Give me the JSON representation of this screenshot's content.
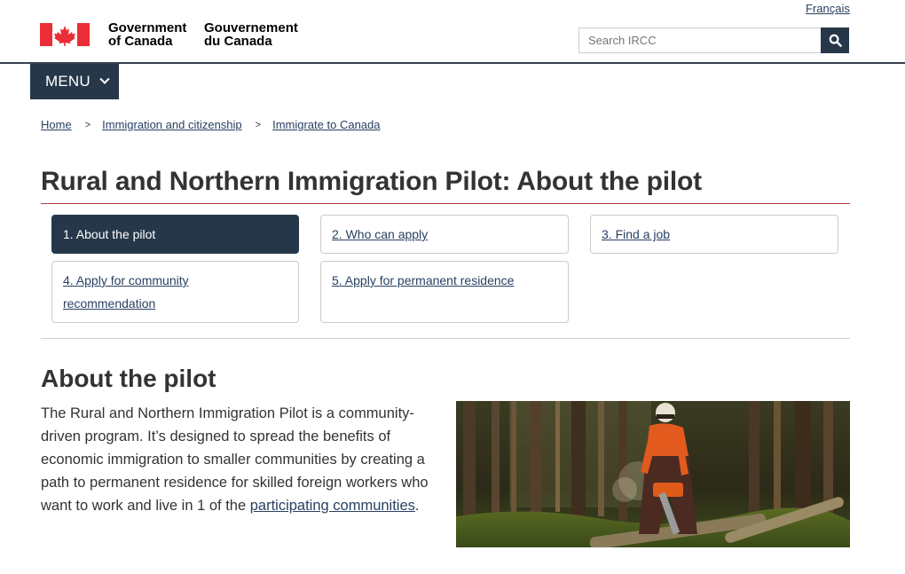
{
  "header": {
    "language_link": "Français",
    "wordmark_en_line1": "Government",
    "wordmark_en_line2": "of Canada",
    "wordmark_fr_line1": "Gouvernement",
    "wordmark_fr_line2": "du Canada",
    "search_placeholder": "Search IRCC",
    "menu_label": "MENU"
  },
  "breadcrumb": [
    {
      "label": "Home"
    },
    {
      "label": "Immigration and citizenship"
    },
    {
      "label": "Immigrate to Canada"
    }
  ],
  "breadcrumb_separator": ">",
  "page_title": "Rural and Northern Immigration Pilot: About the pilot",
  "steps": [
    {
      "label": "1. About the pilot",
      "active": true
    },
    {
      "label": "2. Who can apply",
      "active": false
    },
    {
      "label": "3. Find a job",
      "active": false
    },
    {
      "label": "4. Apply for community recommendation",
      "active": false
    },
    {
      "label": "5. Apply for permanent residence",
      "active": false
    }
  ],
  "section": {
    "heading": "About the pilot",
    "body_before_link": "The Rural and Northern Immigration Pilot is a community-driven program. It’s designed to spread the benefits of economic immigration to smaller communities by creating a path to permanent residence for skilled foreign workers who want to work and live in 1 of the ",
    "link_text": "participating communities",
    "body_after_link": "."
  },
  "icons": {
    "search": "search-icon",
    "chevron": "chevron-down-icon",
    "flag": "canada-flag-icon"
  },
  "colors": {
    "primary": "#26374a",
    "link": "#284162",
    "flag_red": "#eb2d37",
    "title_rule": "#af3c43"
  }
}
